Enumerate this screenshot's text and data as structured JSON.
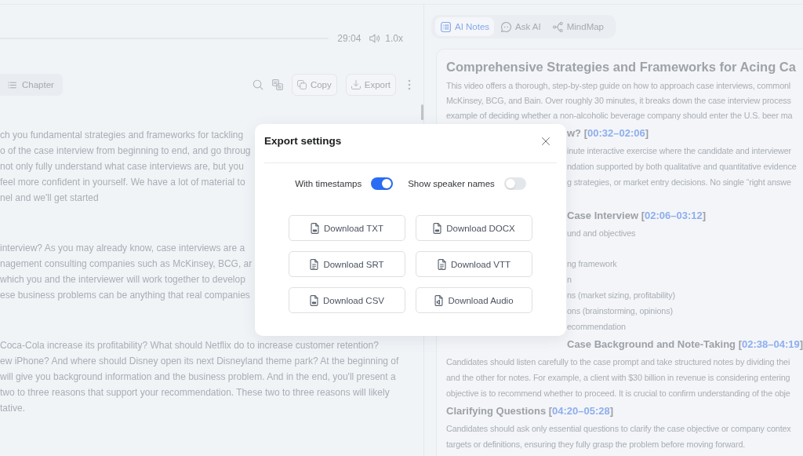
{
  "player": {
    "time": "29:04",
    "speed": "1.0x"
  },
  "toolbar": {
    "chapter": "Chapter",
    "copy": "Copy",
    "export": "Export"
  },
  "transcript": [
    {
      "lines": [
        "ch you fundamental strategies and frameworks for tackling",
        "o of the case interview from beginning to end, and go throug",
        "not only fully understand what case interviews are, but you",
        "feel more confident in yourself. We have a lot of material to",
        "nel and we'll get started"
      ]
    },
    {
      "lines": [
        "interview? As you may already know, case interviews are a",
        "nagement consulting companies such as McKinsey, BCG, ar",
        "which you and the interviewer will work together to develop",
        "ese business problems can be anything that real companies"
      ]
    },
    {
      "lines": [
        "Coca-Cola increase its profitability? What should Netflix do to increase customer retention?",
        "ew iPhone? And where should Disney open its next Disneyland theme park? At the beginning of",
        "will give you background information and the business problem. And in the end, you'll present a",
        "two to three reasons that support your recommendation. These two to three reasons will likely",
        "tative."
      ]
    }
  ],
  "notes": {
    "tabs": [
      {
        "label": "AI Notes",
        "selected": true
      },
      {
        "label": "Ask AI",
        "selected": false
      },
      {
        "label": "MindMap",
        "selected": false
      }
    ],
    "title": "Comprehensive Strategies and Frameworks for Acing Ca",
    "summary": [
      "This video offers a thorough, step-by-step guide on how to approach case interviews, commonl",
      "McKinsey, BCG, and Bain. Over roughly 30 minutes, it breaks down the case interview process",
      "example of deciding whether a non-alcoholic beverage company should enter the U.S. beer ma"
    ],
    "sections": [
      {
        "heading": "w? [",
        "timestamp": "00:32–02:06",
        "heading_end": "]",
        "lines": [
          "inute interactive exercise where the candidate and interviewer",
          "ndation supported by both qualitative and quantitative evidence",
          "g strategies, or market entry decisions. No single “right answe"
        ]
      },
      {
        "heading": "Case Interview [",
        "timestamp": "02:06–03:12",
        "heading_end": "]",
        "lines": [
          "und and objectives"
        ],
        "items": [
          "ng framework",
          "n",
          "ns (market sizing, profitability)",
          "ons (brainstorming, opinions)",
          "ecommendation"
        ]
      },
      {
        "heading": "Case Background and Note-Taking [",
        "timestamp": "02:38–04:19",
        "heading_end": "]",
        "lines": [
          "Candidates should listen carefully to the case prompt and take structured notes by dividing thei",
          "and the other for notes. For example, a client with $30 billion in revenue is considering entering",
          "objective is to recommend whether to proceed. It is crucial to confirm understanding of the obje"
        ]
      },
      {
        "heading": "Clarifying Questions [",
        "timestamp": "04:20–05:28",
        "heading_end": "]",
        "lines": [
          "Candidates should ask only essential questions to clarify the case objective or company contex",
          "targets or definitions, ensuring they fully grasp the problem before moving forward."
        ]
      }
    ]
  },
  "dialog": {
    "title": "Export settings",
    "toggles": [
      {
        "label": "With timestamps",
        "on": true
      },
      {
        "label": "Show speaker names",
        "on": false
      }
    ],
    "buttons": [
      "Download TXT",
      "Download DOCX",
      "Download SRT",
      "Download VTT",
      "Download CSV",
      "Download Audio"
    ]
  }
}
